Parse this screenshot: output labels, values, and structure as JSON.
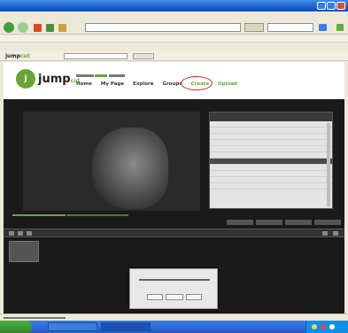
{
  "colors": {
    "brand_green": "#6aa534",
    "highlight_red": "#d02020",
    "titlebar_blue": "#1b5fd0",
    "dark_bg": "#1a1a1a"
  },
  "icons": {
    "back": "back-arrow-icon",
    "forward": "forward-arrow-icon",
    "refresh": "refresh-icon",
    "home": "home-icon",
    "stop": "stop-icon"
  },
  "site": {
    "logo_text": "jump",
    "logo_suffix": "cut",
    "nav": [
      "Home",
      "My Page",
      "Explore",
      "Groups",
      "Create",
      "Upload"
    ]
  }
}
